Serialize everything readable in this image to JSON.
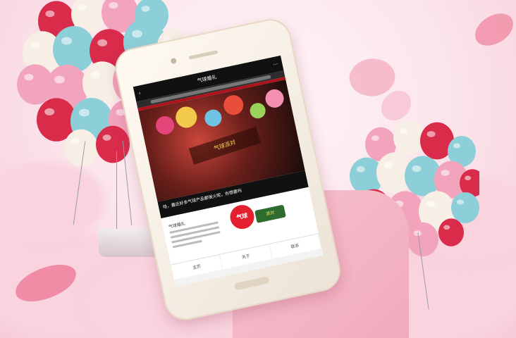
{
  "colors": {
    "sky": "#fbe9ee",
    "cloud": "#f9d3de",
    "balloon_red": "#d92b4a",
    "balloon_pink": "#f2a4bd",
    "balloon_teal": "#8ccfd8",
    "balloon_cream": "#f7efe6",
    "phone_bezel": "#f4ecdf",
    "screen_header": "#111111",
    "accent_red": "#b0121b"
  },
  "icons": [
    "back-icon",
    "more-icon",
    "home-key"
  ],
  "phone_screen": {
    "header_title": "气球婚礼",
    "poster_text": "气球派对",
    "caption": "哇，最近好多气球产品都很火呢，你想要吗",
    "card_title": "气球婚礼",
    "logo_red_text": "气球",
    "logo_green_text": "派对",
    "tabs": [
      "主页",
      "关于",
      "联系"
    ]
  }
}
